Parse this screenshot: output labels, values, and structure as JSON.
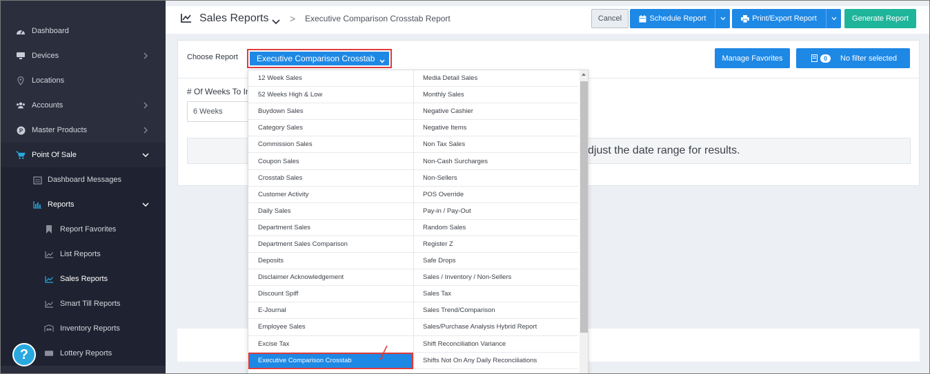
{
  "sidebar": {
    "items": [
      {
        "label": "Dashboard",
        "icon": "dashboard-icon"
      },
      {
        "label": "Devices",
        "icon": "devices-icon"
      },
      {
        "label": "Locations",
        "icon": "location-pin-icon"
      },
      {
        "label": "Accounts",
        "icon": "users-icon"
      },
      {
        "label": "Master Products",
        "icon": "products-icon"
      },
      {
        "label": "Point Of Sale",
        "icon": "cart-icon"
      },
      {
        "label": "Dashboard Messages",
        "icon": "messages-icon"
      },
      {
        "label": "Reports",
        "icon": "bar-chart-icon"
      },
      {
        "label": "Report Favorites",
        "icon": "bookmark-icon"
      },
      {
        "label": "List Reports",
        "icon": "line-chart-icon"
      },
      {
        "label": "Sales Reports",
        "icon": "line-chart-icon"
      },
      {
        "label": "Smart Till Reports",
        "icon": "line-chart-icon"
      },
      {
        "label": "Inventory Reports",
        "icon": "inventory-icon"
      },
      {
        "label": "Lottery Reports",
        "icon": "ticket-icon"
      }
    ],
    "help_label": "?"
  },
  "header": {
    "title": "Sales Reports",
    "separator": ">",
    "breadcrumb": "Executive Comparison Crosstab Report",
    "cancel_label": "Cancel",
    "schedule_label": "Schedule Report",
    "print_label": "Print/Export Report",
    "generate_label": "Generate Report"
  },
  "report": {
    "choose_label": "Choose Report",
    "selected": "Executive Comparison Crosstab",
    "manage_favorites_label": "Manage Favorites",
    "filter_count": "0",
    "filter_label": "No filter selected",
    "weeks_label": "# Of Weeks To In",
    "weeks_value": "6 Weeks",
    "notice_text": "djust the date range for results."
  },
  "dropdown": {
    "left": [
      "12 Week Sales",
      "52 Weeks High & Low",
      "Buydown Sales",
      "Category Sales",
      "Commission Sales",
      "Coupon Sales",
      "Crosstab Sales",
      "Customer Activity",
      "Daily Sales",
      "Department Sales",
      "Department Sales Comparison",
      "Deposits",
      "Disclaimer Acknowledgement",
      "Discount Spiff",
      "E-Journal",
      "Employee Sales",
      "Excise Tax",
      "Executive Comparison Crosstab"
    ],
    "right": [
      "Media Detail Sales",
      "Monthly Sales",
      "Negative Cashier",
      "Negative Items",
      "Non Tax Sales",
      "Non-Cash Surcharges",
      "Non-Sellers",
      "POS Override",
      "Pay-in / Pay-Out",
      "Random Sales",
      "Register Z",
      "Safe Drops",
      "Sales / Inventory / Non-Sellers",
      "Sales Tax",
      "Sales Trend/Comparison",
      "Sales/Purchase Analysis Hybrid Report",
      "Shift Reconciliation Variance",
      "Shifts Not On Any Daily Reconciliations"
    ]
  },
  "colors": {
    "sidebar_bg": "#2b2f3d",
    "primary": "#1e88e5",
    "success": "#1fb59a",
    "highlight_border": "#e03a3a"
  }
}
